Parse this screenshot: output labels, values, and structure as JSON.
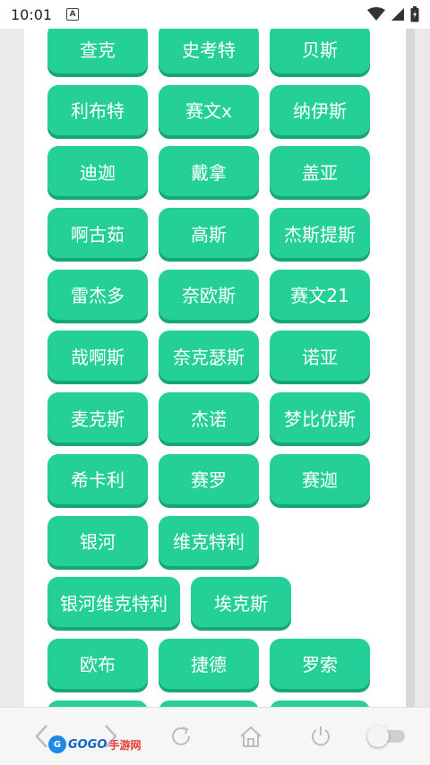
{
  "status_bar": {
    "time": "10:01",
    "notification_letter": "A"
  },
  "tags": [
    [
      "查克",
      "史考特",
      "贝斯"
    ],
    [
      "利布特",
      "赛文x",
      "纳伊斯"
    ],
    [
      "迪迦",
      "戴拿",
      "盖亚"
    ],
    [
      "啊古茹",
      "高斯",
      "杰斯提斯"
    ],
    [
      "雷杰多",
      "奈欧斯",
      "赛文21"
    ],
    [
      "哉啊斯",
      "奈克瑟斯",
      "诺亚"
    ],
    [
      "麦克斯",
      "杰诺",
      "梦比优斯"
    ],
    [
      "希卡利",
      "赛罗",
      "赛迦"
    ],
    [
      "银河",
      "维克特利"
    ],
    [
      "银河维克特利",
      "埃克斯"
    ],
    [
      "欧布",
      "捷德",
      "罗索"
    ],
    [
      "",
      "",
      ""
    ]
  ],
  "bottom_bar": {
    "logo_text": "GOGO",
    "logo_sub": "手游网",
    "icons": [
      "back-icon",
      "forward-icon",
      "refresh-icon",
      "home-icon",
      "power-icon",
      "toggle-switch"
    ]
  },
  "colors": {
    "tag_bg": "#24cf98",
    "tag_shadow": "#17a676",
    "page_bg": "#ffffff"
  }
}
